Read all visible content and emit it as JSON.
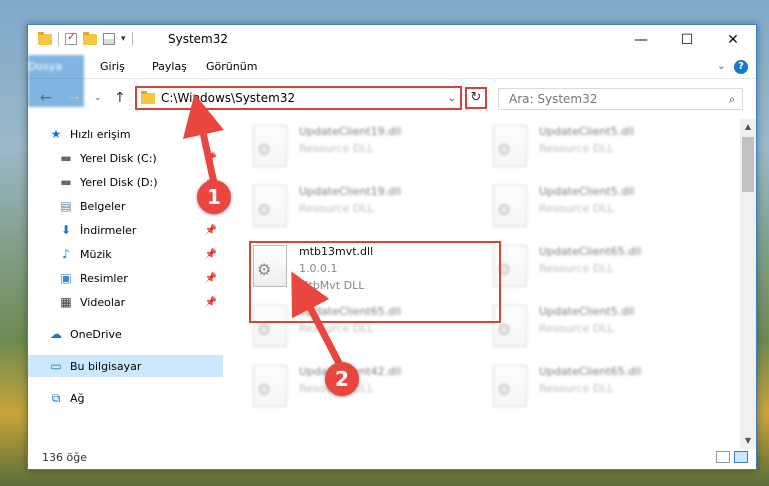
{
  "window": {
    "title": "System32",
    "controls": {
      "minimize": "—",
      "maximize": "☐",
      "close": "✕"
    }
  },
  "ribbon": {
    "tabs": [
      "Dosya",
      "Giriş",
      "Paylaş",
      "Görünüm"
    ],
    "help": "?"
  },
  "nav": {
    "address": "C:\\Windows\\System32",
    "search_placeholder": "Ara: System32"
  },
  "sidebar": {
    "items": [
      {
        "label": "Hızlı erişim",
        "icon": "star-icon",
        "pinned": false
      },
      {
        "label": "Yerel Disk (C:)",
        "icon": "drive-icon",
        "pinned": true
      },
      {
        "label": "Yerel Disk (D:)",
        "icon": "drive-icon",
        "pinned": true
      },
      {
        "label": "Belgeler",
        "icon": "document-icon",
        "pinned": true
      },
      {
        "label": "İndirmeler",
        "icon": "download-icon",
        "pinned": true
      },
      {
        "label": "Müzik",
        "icon": "music-icon",
        "pinned": true
      },
      {
        "label": "Resimler",
        "icon": "picture-icon",
        "pinned": true
      },
      {
        "label": "Videolar",
        "icon": "video-icon",
        "pinned": true
      },
      {
        "label": "OneDrive",
        "icon": "cloud-icon",
        "pinned": false
      },
      {
        "label": "Bu bilgisayar",
        "icon": "computer-icon",
        "pinned": false
      },
      {
        "label": "Ağ",
        "icon": "network-icon",
        "pinned": false
      }
    ]
  },
  "files": [
    {
      "name": "UpdateClient19.dll",
      "sub": "Resource DLL"
    },
    {
      "name": "UpdateClient5.dll",
      "sub": "Resource DLL"
    },
    {
      "name": "UpdateClient19.dll",
      "sub": "Resource DLL"
    },
    {
      "name": "UpdateClient5.dll",
      "sub": "Resource DLL"
    },
    {
      "name": "mtb13mvt.dll",
      "version": "1.0.0.1",
      "sub": "MtbMvt DLL"
    },
    {
      "name": "UpdateClient65.dll",
      "sub": "Resource DLL"
    },
    {
      "name": "UpdateClient65.dll",
      "sub": "Resource DLL"
    },
    {
      "name": "UpdateClient5.dll",
      "sub": "Resource DLL"
    },
    {
      "name": "UpdateClient42.dll",
      "sub": "Resource DLL"
    },
    {
      "name": "UpdateClient65.dll",
      "sub": "Resource DLL"
    }
  ],
  "status": {
    "count": "136 öğe"
  },
  "annotations": {
    "step1": "1",
    "step2": "2",
    "color": "#e8463f"
  }
}
